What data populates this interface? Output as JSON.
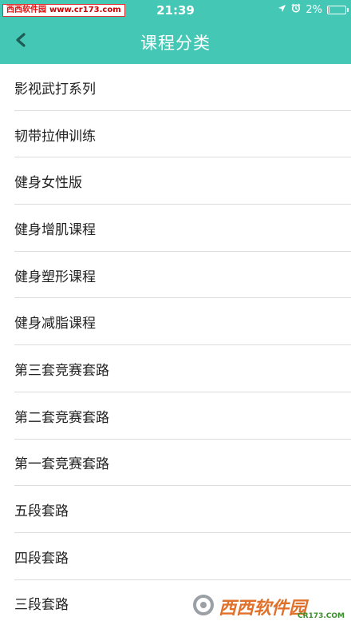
{
  "status": {
    "time": "21:39",
    "battery": "2%",
    "battery_level": 0.02
  },
  "watermark": {
    "site_name": "西西软件园",
    "url": "www.cr173.com",
    "bottom_logo": "西西软件园",
    "bottom_url": "CR173.COM"
  },
  "nav": {
    "title": "课程分类"
  },
  "colors": {
    "header": "#45c7b6",
    "divider": "#dcdcdc"
  },
  "categories": [
    {
      "label": "影视武打系列"
    },
    {
      "label": "韧带拉伸训练"
    },
    {
      "label": "健身女性版"
    },
    {
      "label": "健身增肌课程"
    },
    {
      "label": "健身塑形课程"
    },
    {
      "label": "健身减脂课程"
    },
    {
      "label": "第三套竞赛套路"
    },
    {
      "label": "第二套竞赛套路"
    },
    {
      "label": "第一套竞赛套路"
    },
    {
      "label": "五段套路"
    },
    {
      "label": "四段套路"
    },
    {
      "label": "三段套路"
    }
  ]
}
